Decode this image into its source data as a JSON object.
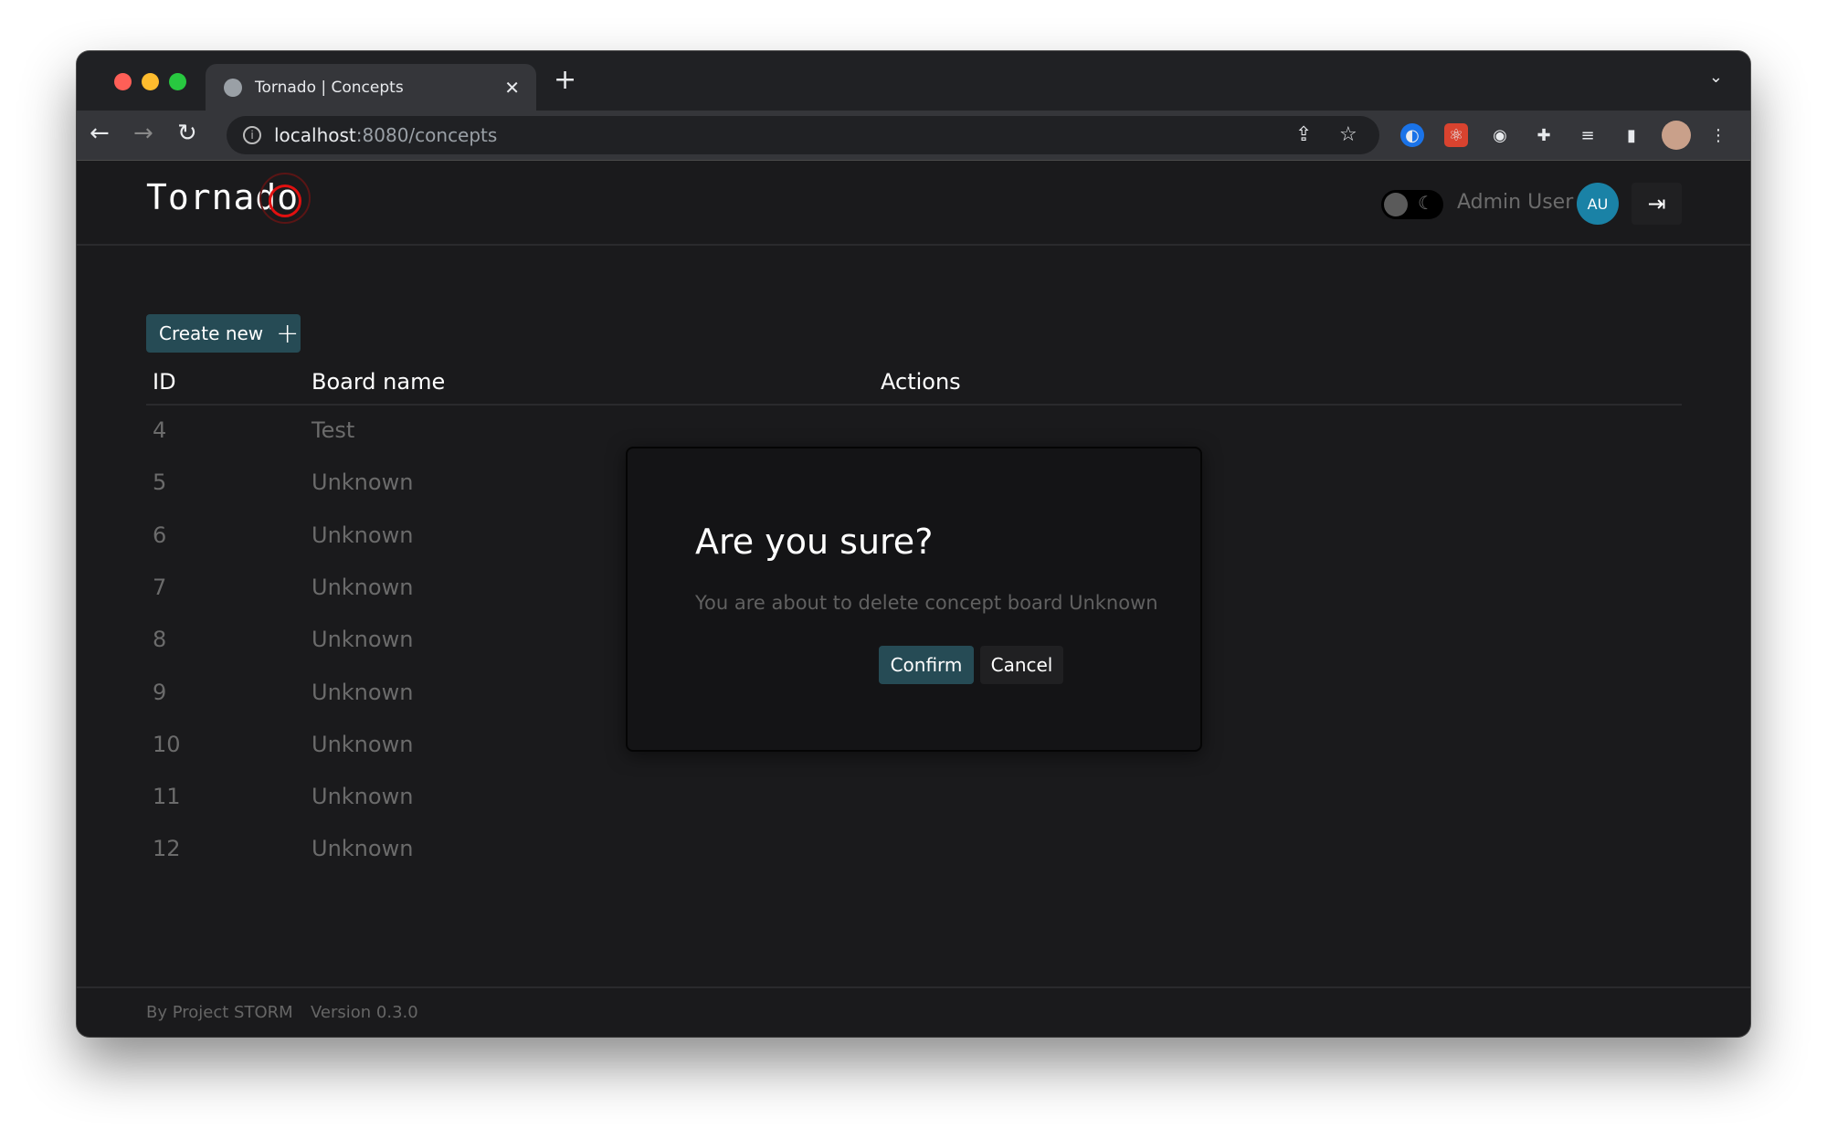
{
  "browser": {
    "tab_title": "Tornado | Concepts",
    "url_host": "localhost",
    "url_path": ":8080/concepts"
  },
  "app": {
    "logo": "Tornado",
    "user_name": "Admin User",
    "avatar_initials": "AU",
    "accent": "#264b55",
    "avatar_color": "#1a82a6"
  },
  "toolbar": {
    "create_label": "Create new"
  },
  "table": {
    "headers": [
      "ID",
      "Board name",
      "Actions"
    ],
    "rows": [
      {
        "id": "4",
        "name": "Test"
      },
      {
        "id": "5",
        "name": "Unknown"
      },
      {
        "id": "6",
        "name": "Unknown"
      },
      {
        "id": "7",
        "name": "Unknown"
      },
      {
        "id": "8",
        "name": "Unknown"
      },
      {
        "id": "9",
        "name": "Unknown"
      },
      {
        "id": "10",
        "name": "Unknown"
      },
      {
        "id": "11",
        "name": "Unknown"
      },
      {
        "id": "12",
        "name": "Unknown"
      }
    ]
  },
  "dialog": {
    "title": "Are you sure?",
    "message": "You are about to delete concept board Unknown",
    "confirm": "Confirm",
    "cancel": "Cancel"
  },
  "footer": {
    "by": "By Project STORM",
    "version": "Version 0.3.0"
  }
}
